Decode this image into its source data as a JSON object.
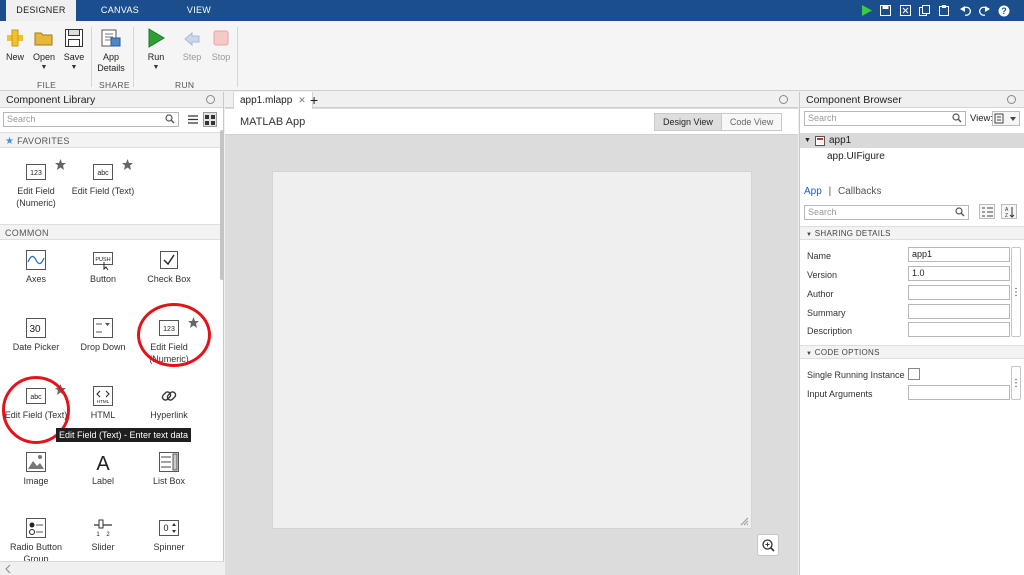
{
  "topbar": {
    "tabs": [
      "DESIGNER",
      "CANVAS",
      "VIEW"
    ]
  },
  "toolstrip": {
    "file": {
      "section_label": "FILE",
      "new_label": "New",
      "open_label": "Open",
      "save_label": "Save"
    },
    "share": {
      "section_label": "SHARE",
      "app_details_label": "App Details"
    },
    "run": {
      "section_label": "RUN",
      "run_label": "Run",
      "step_label": "Step",
      "stop_label": "Stop"
    }
  },
  "component_library": {
    "title": "Component Library",
    "search_placeholder": "Search",
    "favorites": {
      "label": "FAVORITES",
      "items": [
        "Edit Field (Numeric)",
        "Edit Field (Text)"
      ]
    },
    "common": {
      "label": "COMMON",
      "items": [
        "Axes",
        "Button",
        "Check Box",
        "Date Picker",
        "Drop Down",
        "Edit Field (Numeric)",
        "Edit Field (Text)",
        "HTML",
        "Hyperlink",
        "Image",
        "Label",
        "List Box",
        "Radio Button Group",
        "Slider",
        "Spinner"
      ]
    },
    "icon_text": {
      "numeric": "123",
      "text": "abc",
      "button": "PUSH",
      "date": "30",
      "html": "HTML"
    },
    "tooltip": "Edit Field (Text) - Enter text data"
  },
  "editor": {
    "tab_label": "app1.mlapp",
    "app_title": "MATLAB App",
    "design_view_label": "Design View",
    "code_view_label": "Code View"
  },
  "component_browser": {
    "title": "Component Browser",
    "search_placeholder": "Search",
    "view_label": "View:",
    "tree": {
      "root": "app1",
      "child": "app.UIFigure"
    },
    "inspector_tabs": {
      "app": "App",
      "separator": "|",
      "callbacks": "Callbacks"
    },
    "inspector_search_placeholder": "Search",
    "sharing_details": {
      "label": "SHARING DETAILS",
      "name_label": "Name",
      "name_value": "app1",
      "version_label": "Version",
      "version_value": "1.0",
      "author_label": "Author",
      "author_value": "",
      "summary_label": "Summary",
      "summary_value": "",
      "description_label": "Description",
      "description_value": ""
    },
    "code_options": {
      "label": "CODE OPTIONS",
      "single_instance_label": "Single Running Instance",
      "single_instance_checked": false,
      "input_args_label": "Input Arguments",
      "input_args_value": ""
    }
  },
  "colors": {
    "accent": "#1a4e8c",
    "highlight": "#e2141a",
    "run_green": "#2e9e36"
  }
}
